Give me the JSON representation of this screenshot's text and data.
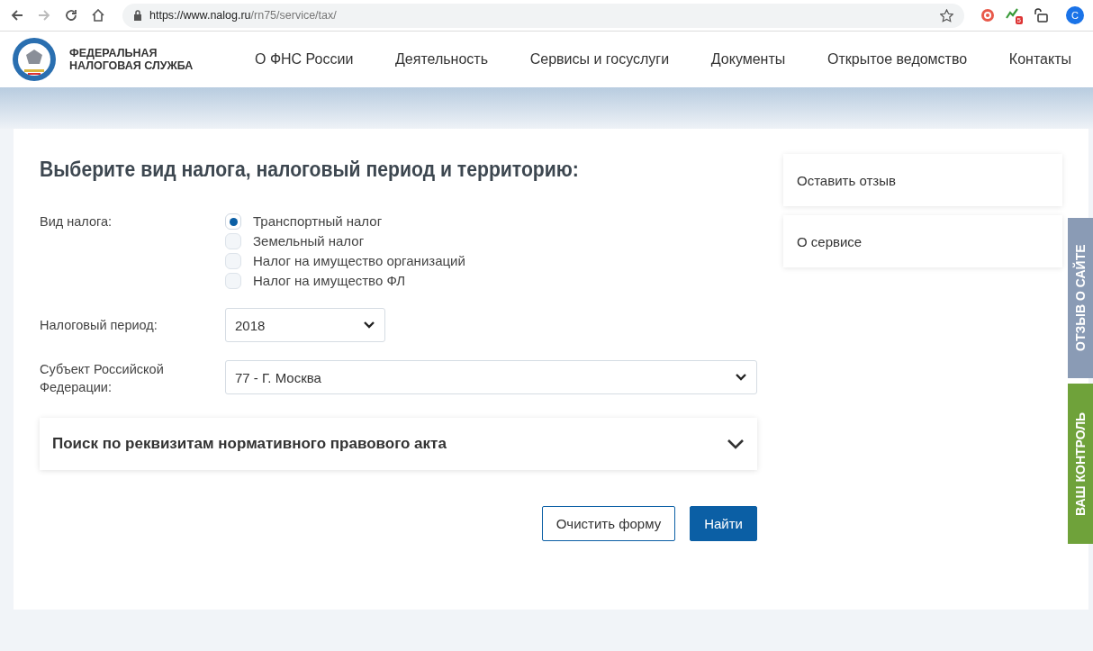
{
  "browser": {
    "url_host": "https://www.nalog.ru",
    "url_path": "/rn75/service/tax/",
    "extension_badge": "5",
    "profile_initial": "C"
  },
  "header": {
    "logo_line1": "ФЕДЕРАЛЬНАЯ",
    "logo_line2": "НАЛОГОВАЯ СЛУЖБА",
    "nav": [
      "О ФНС России",
      "Деятельность",
      "Сервисы и госуслуги",
      "Документы",
      "Открытое ведомство",
      "Контакты"
    ]
  },
  "form": {
    "title": "Выберите вид налога, налоговый период и территорию:",
    "tax_type_label": "Вид налога:",
    "tax_types": [
      {
        "label": "Транспортный налог",
        "selected": true
      },
      {
        "label": "Земельный налог",
        "selected": false
      },
      {
        "label": "Налог на имущество организаций",
        "selected": false
      },
      {
        "label": "Налог на имущество ФЛ",
        "selected": false
      }
    ],
    "period_label": "Налоговый период:",
    "period_value": "2018",
    "region_label": "Субъект Российской Федерации:",
    "region_value": "77 - Г. Москва",
    "search_section": {
      "title": "Поиск по реквизитам нормативного правового акта",
      "expanded": false
    },
    "buttons": {
      "clear": "Очистить форму",
      "find": "Найти"
    }
  },
  "sidebar": [
    "Оставить отзыв",
    "О сервисе"
  ],
  "side_tabs": [
    {
      "label": "ОТЗЫВ О САЙТЕ",
      "color": "#8a9bb5"
    },
    {
      "label": "ВАШ КОНТРОЛЬ",
      "color": "#6fa23a"
    }
  ]
}
